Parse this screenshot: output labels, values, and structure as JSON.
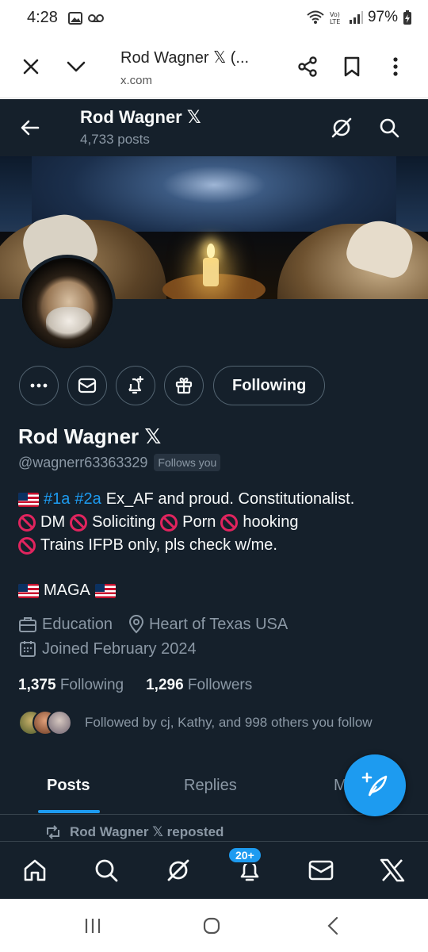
{
  "status_bar": {
    "time": "4:28",
    "battery": "97%"
  },
  "browser": {
    "title": "Rod Wagner 𝕏 (...",
    "url": "x.com"
  },
  "header": {
    "name": "Rod Wagner 𝕏",
    "posts_count": "4,733 posts"
  },
  "profile": {
    "name": "Rod Wagner 𝕏",
    "handle": "@wagnerr63363329",
    "follows_you": "Follows you",
    "follow_button": "Following",
    "bio": {
      "line1_tag1": "#1a",
      "line1_tag2": "#2a",
      "line1_text": "Ex_AF and proud.  Constitutionalist.",
      "line2_a": "DM",
      "line2_b": "Soliciting",
      "line2_c": "Porn",
      "line2_d": "hooking",
      "line3": "Trains IFPB only, pls check w/me.",
      "line4": "MAGA"
    },
    "profession": "Education",
    "location": "Heart of Texas USA",
    "joined": "Joined February 2024",
    "following_count": "1,375",
    "following_label": "Following",
    "followers_count": "1,296",
    "followers_label": "Followers",
    "followed_by": "Followed by cj, Kathy, and 998 others you follow"
  },
  "tabs": [
    {
      "label": "Posts",
      "active": true
    },
    {
      "label": "Replies",
      "active": false
    },
    {
      "label": "M",
      "active": false
    }
  ],
  "repost_line": "Rod Wagner 𝕏 reposted",
  "bottom_nav": {
    "notifications_badge": "20+"
  },
  "colors": {
    "background": "#15202b",
    "accent": "#1d9bf0",
    "muted": "#8b98a5"
  }
}
